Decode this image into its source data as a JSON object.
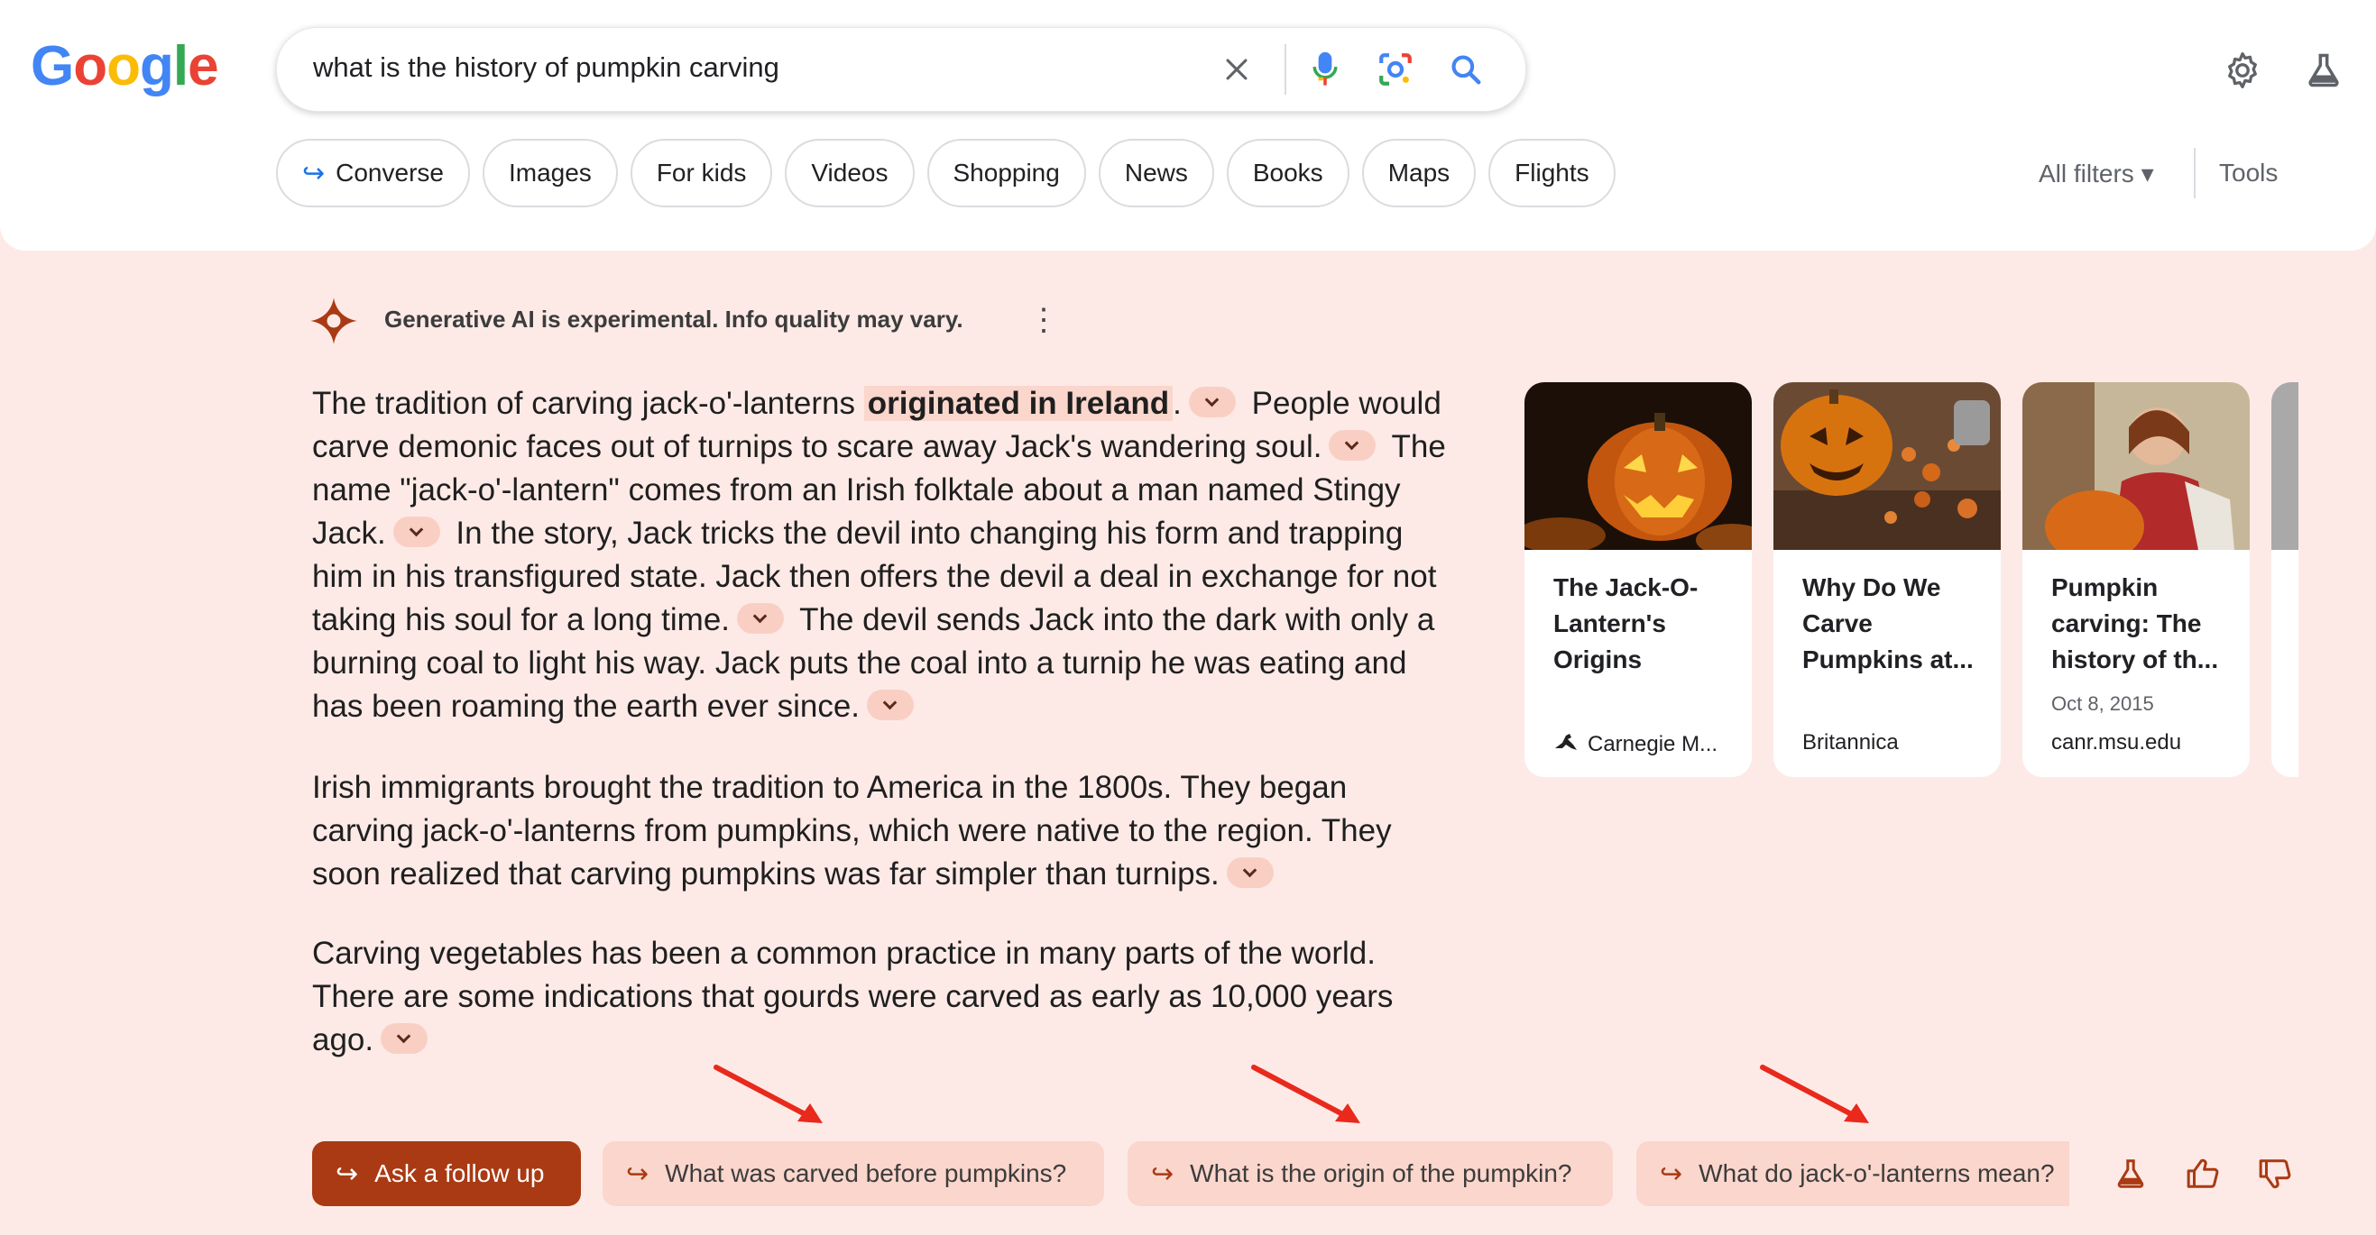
{
  "logo": {
    "text": "Google"
  },
  "search": {
    "query": "what is the history of pumpkin carving",
    "icons": [
      "close-icon",
      "microphone-icon",
      "lens-icon",
      "search-icon"
    ]
  },
  "header_icons": [
    "gear-icon",
    "labs-flask-icon"
  ],
  "chips": [
    {
      "label": "Converse",
      "icon": "converse-arrow-icon"
    },
    {
      "label": "Images"
    },
    {
      "label": "For kids"
    },
    {
      "label": "Videos"
    },
    {
      "label": "Shopping"
    },
    {
      "label": "News"
    },
    {
      "label": "Books"
    },
    {
      "label": "Maps"
    },
    {
      "label": "Flights"
    }
  ],
  "filters": {
    "all_filters": "All filters ▾",
    "tools": "Tools"
  },
  "ai": {
    "notice": "Generative AI is experimental. Info quality may vary.",
    "kebab": "⋮",
    "p1": {
      "a": "The tradition of carving jack-o'-lanterns ",
      "hl": "originated in Ireland",
      "b": ".",
      "c": " People would carve demonic faces out of turnips to scare away Jack's wandering soul.",
      "d": " The name \"jack-o'-lantern\" comes from an Irish folktale about a man named Stingy Jack.",
      "e": " In the story, Jack tricks the devil into changing his form and trapping him in his transfigured state. Jack then offers the devil a deal in exchange for not taking his soul for a long time.",
      "f": " The devil sends Jack into the dark with only a burning coal to light his way. Jack puts the coal into a turnip he was eating and has been roaming the earth ever since."
    },
    "p2": "Irish immigrants brought the tradition to America in the 1800s. They began carving jack-o'-lanterns from pumpkins, which were native to the region. They soon realized that carving pumpkins was far simpler than turnips.",
    "p3": "Carving vegetables has been a common practice in many parts of the world. There are some indications that gourds were carved as early as 10,000 years ago."
  },
  "cards": [
    {
      "title": "The Jack-O-Lantern's Origins",
      "date": "",
      "source": "Carnegie M..."
    },
    {
      "title": "Why Do We Carve Pumpkins at...",
      "date": "",
      "source": "Britannica"
    },
    {
      "title": "Pumpkin carving: The history of th...",
      "date": "Oct 8, 2015",
      "source": "canr.msu.edu"
    }
  ],
  "followups": {
    "ask": "Ask a follow up",
    "items": [
      "What was carved before pumpkins?",
      "What is the origin of the pumpkin?",
      "What do jack-o'-lanterns mean?"
    ]
  },
  "bottom_icons": [
    "labs-flask-icon",
    "thumbs-up-icon",
    "thumbs-down-icon"
  ],
  "colors": {
    "accent": "#a93a13",
    "background": "#fdeae6",
    "chip_fill": "#fad6cc",
    "annotation_arrow": "#e8291c"
  }
}
